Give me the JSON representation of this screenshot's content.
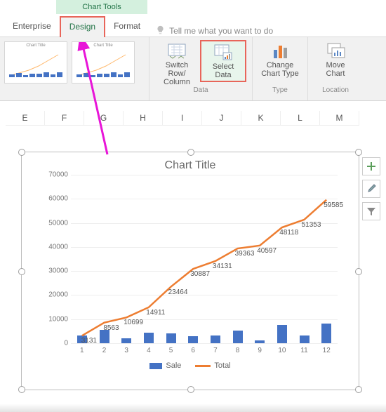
{
  "ribbon": {
    "chart_tools": "Chart Tools",
    "tabs": {
      "enterprise": "Enterprise",
      "design": "Design",
      "format": "Format"
    },
    "tell_me": "Tell me what you want to do",
    "buttons": {
      "switch": {
        "l1": "Switch Row/",
        "l2": "Column"
      },
      "select": {
        "l1": "Select",
        "l2": "Data"
      },
      "change": {
        "l1": "Change",
        "l2": "Chart Type"
      },
      "move": {
        "l1": "Move",
        "l2": "Chart"
      }
    },
    "groups": {
      "data": "Data",
      "type": "Type",
      "location": "Location"
    }
  },
  "columns": [
    "E",
    "F",
    "G",
    "H",
    "I",
    "J",
    "K",
    "L",
    "M"
  ],
  "chart": {
    "title": "Chart Title",
    "legend": {
      "sale": "Sale",
      "total": "Total"
    }
  },
  "chart_data": {
    "type": "combo",
    "categories": [
      1,
      2,
      3,
      4,
      5,
      6,
      7,
      8,
      9,
      10,
      11,
      12
    ],
    "series": [
      {
        "name": "Sale",
        "type": "bar",
        "values": [
          3131,
          5432,
          2136,
          4489,
          4212,
          3000,
          3244,
          5219,
          1234,
          7521,
          3235,
          8232
        ]
      },
      {
        "name": "Total",
        "type": "line",
        "values": [
          3131,
          8563,
          10699,
          14911,
          23464,
          30887,
          34131,
          39363,
          40597,
          48118,
          51353,
          59585
        ],
        "labels_visible": true
      }
    ],
    "ylim": [
      0,
      70000
    ],
    "y_ticks": [
      0,
      10000,
      20000,
      30000,
      40000,
      50000,
      60000,
      70000
    ],
    "xlabel": "",
    "ylabel": ""
  }
}
